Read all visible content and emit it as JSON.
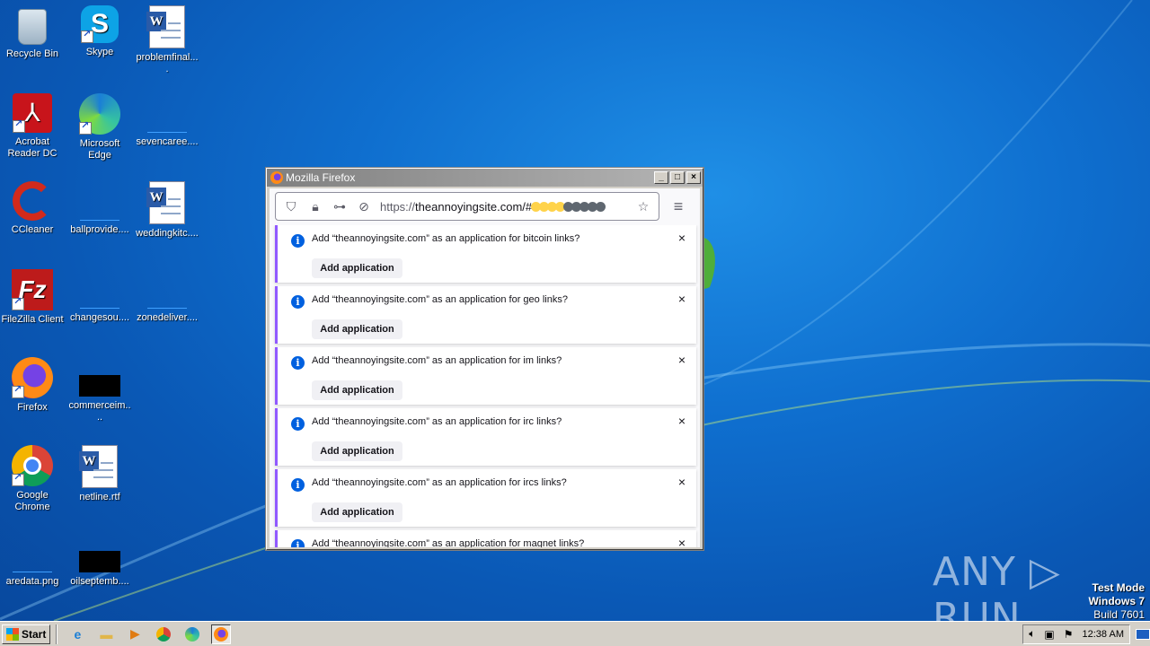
{
  "desktop": {
    "icons": [
      {
        "label": "Recycle Bin",
        "icon": "recycle-bin-icon"
      },
      {
        "label": "Skype",
        "icon": "skype-icon"
      },
      {
        "label": "problemfinal....",
        "icon": "word-document-icon"
      },
      {
        "label": "Acrobat Reader DC",
        "icon": "acrobat-icon"
      },
      {
        "label": "Microsoft Edge",
        "icon": "edge-icon"
      },
      {
        "label": "sevencaree....",
        "icon": "blank-file-icon"
      },
      {
        "label": "CCleaner",
        "icon": "ccleaner-icon"
      },
      {
        "label": "ballprovide....",
        "icon": "blank-file-icon"
      },
      {
        "label": "weddingkitc....",
        "icon": "word-document-icon"
      },
      {
        "label": "FileZilla Client",
        "icon": "filezilla-icon"
      },
      {
        "label": "changesou....",
        "icon": "blank-file-icon"
      },
      {
        "label": "zonedeliver....",
        "icon": "blank-file-icon"
      },
      {
        "label": "Firefox",
        "icon": "firefox-icon"
      },
      {
        "label": "commerceim....",
        "icon": "black-file-icon"
      },
      {
        "label": "Google Chrome",
        "icon": "chrome-icon"
      },
      {
        "label": "netline.rtf",
        "icon": "word-document-icon"
      },
      {
        "label": "aredata.png",
        "icon": "blank-file-icon"
      },
      {
        "label": "oilseptemb....",
        "icon": "black-file-icon"
      }
    ]
  },
  "window": {
    "title": "Mozilla Firefox",
    "controls": [
      "_",
      "□",
      "×"
    ]
  },
  "browser": {
    "url_protocol": "https://",
    "url_host": "theannoyingsite.com/#",
    "url_dot_colors": [
      "#ffd34a",
      "#ffd34a",
      "#ffd34a",
      "#ffd34a",
      "#5f6770",
      "#5f6770",
      "#5f6770",
      "#5f6770",
      "#5f6770"
    ],
    "menu_glyph": "≡",
    "info_glyph": "i",
    "close_glyph": "×",
    "button_label": "Add application",
    "notifications": [
      {
        "text": "Add “theannoyingsite.com” as an application for bitcoin links?"
      },
      {
        "text": "Add “theannoyingsite.com” as an application for geo links?"
      },
      {
        "text": "Add “theannoyingsite.com” as an application for im links?"
      },
      {
        "text": "Add “theannoyingsite.com” as an application for irc links?"
      },
      {
        "text": "Add “theannoyingsite.com” as an application for ircs links?"
      },
      {
        "text": "Add “theannoyingsite.com” as an application for magnet links?"
      }
    ]
  },
  "watermark": {
    "brand": "ANY ▷ RUN",
    "line1": "Test Mode",
    "line2": "Windows 7",
    "line3": "Build 7601"
  },
  "taskbar": {
    "start_label": "Start",
    "clock": "12:38 AM"
  },
  "colors": {
    "accent_purple": "#9059ff",
    "info_blue": "#0060df"
  }
}
